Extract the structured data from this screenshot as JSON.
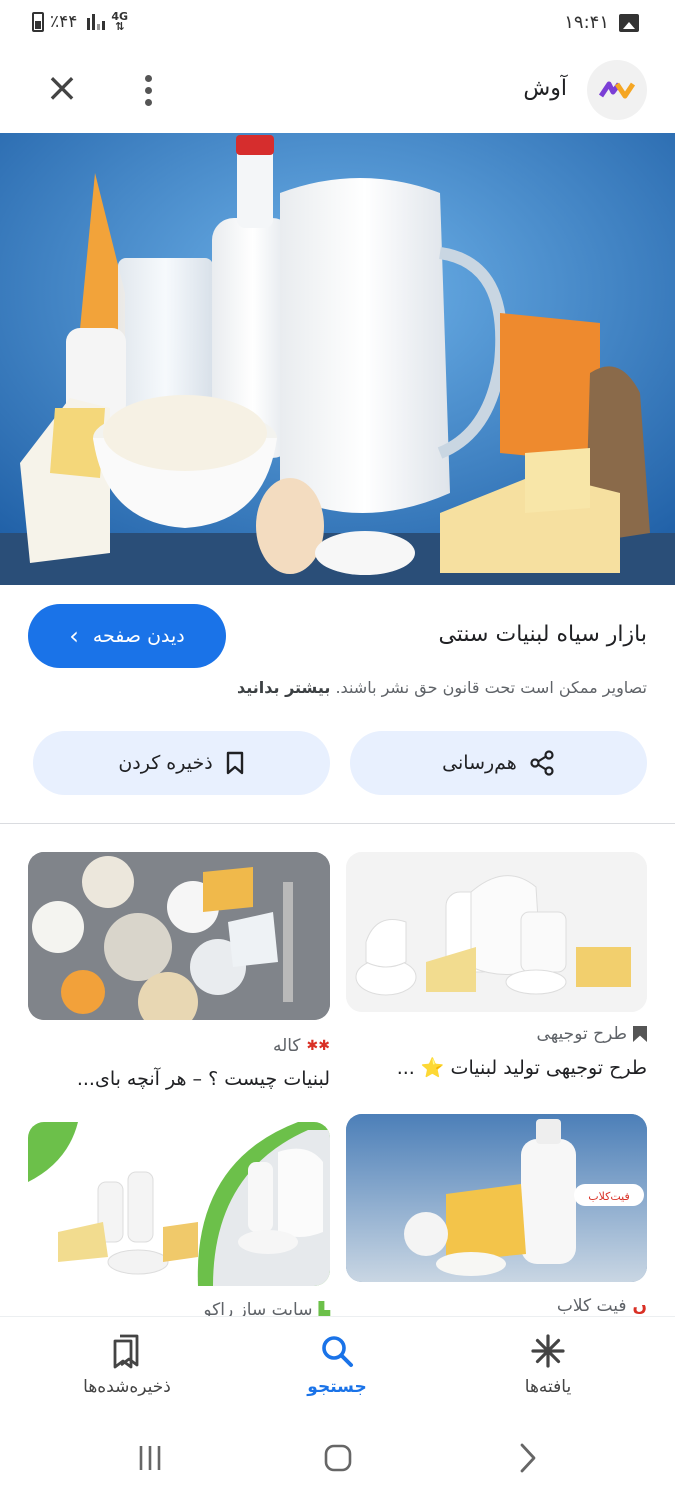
{
  "status_bar": {
    "battery": "٪۴۴",
    "network": "4G",
    "time": "۱۹:۴۱"
  },
  "app_bar": {
    "site_name": "آوش",
    "close_icon": "close-icon",
    "more_icon": "more-vert-icon"
  },
  "hero": {
    "alt": "dairy products image"
  },
  "details": {
    "title": "بازار سیاه لبنیات سنتی",
    "visit_label": "دیدن صفحه",
    "copyright_text": "تصاویر ممکن است تحت قانون حق نشر باشند.",
    "learn_more": "بیشتر بدانید",
    "share_label": "هم‌رسانی",
    "save_label": "ذخیره کردن"
  },
  "results": [
    {
      "source": "طرح توجیهی",
      "title": "طرح توجیهی تولید لبنیات ⭐ ..."
    },
    {
      "source": "کاله",
      "title": "لبنیات چیست ؟ – هر آنچه بای..."
    },
    {
      "source": "فیت کلاب",
      "title": ""
    },
    {
      "source": "سایت ساز راکو",
      "title": ""
    }
  ],
  "bottom_nav": {
    "discoveries": "یافته‌ها",
    "search": "جستجو",
    "saved": "ذخیره‌شده‌ها"
  },
  "colors": {
    "accent": "#1a73e8",
    "chip_bg": "#e8f0fe"
  }
}
